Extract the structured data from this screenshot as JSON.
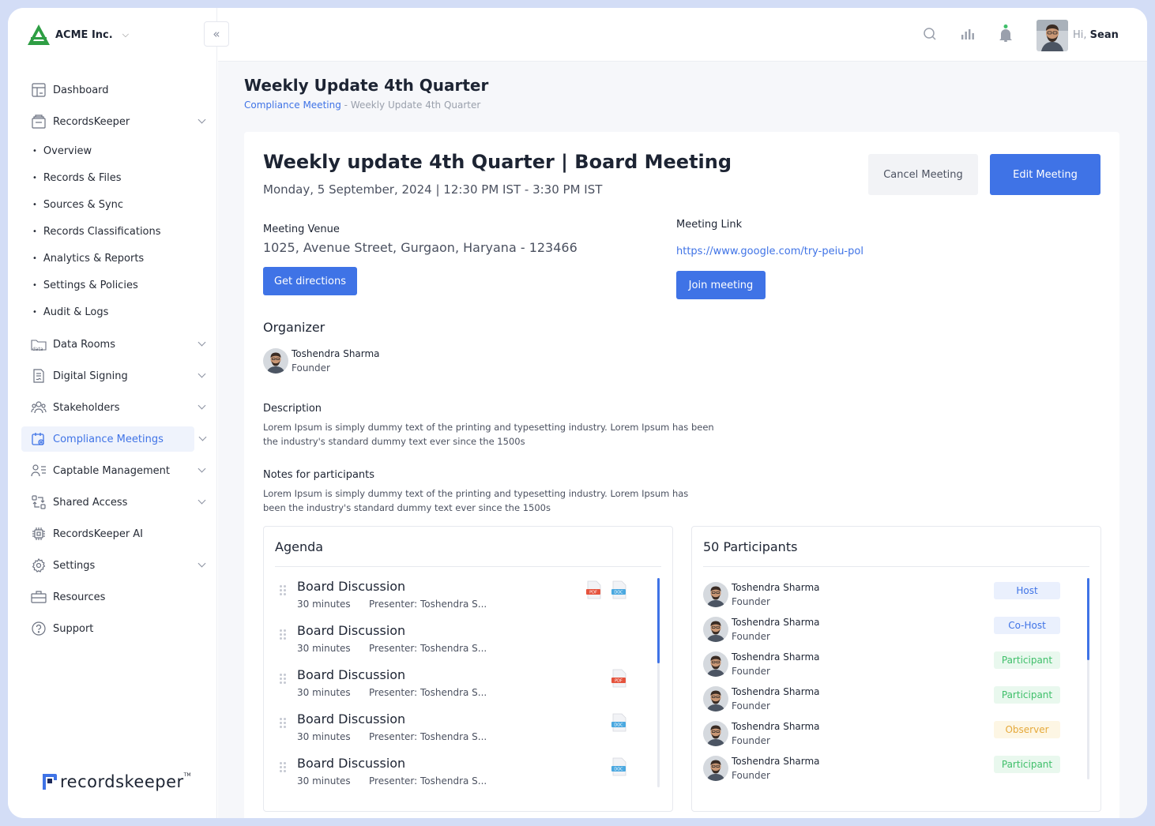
{
  "brand": {
    "name": "ACME Inc."
  },
  "sidebar": {
    "items": [
      {
        "label": "Dashboard"
      },
      {
        "label": "RecordsKeeper"
      },
      {
        "label": "Data Rooms"
      },
      {
        "label": "Digital Signing"
      },
      {
        "label": "Stakeholders"
      },
      {
        "label": "Compliance Meetings"
      },
      {
        "label": "Captable Management"
      },
      {
        "label": "Shared Access"
      },
      {
        "label": "RecordsKeeper AI"
      },
      {
        "label": "Settings"
      },
      {
        "label": "Resources"
      },
      {
        "label": "Support"
      }
    ],
    "subitems": [
      {
        "label": "Overview"
      },
      {
        "label": "Records & Files"
      },
      {
        "label": "Sources & Sync"
      },
      {
        "label": "Records Classifications"
      },
      {
        "label": "Analytics & Reports"
      },
      {
        "label": "Settings & Policies"
      },
      {
        "label": "Audit & Logs"
      }
    ],
    "footer_logo": "recordskeeper",
    "footer_tm": "TM"
  },
  "topbar": {
    "greeting": "Hi,",
    "user": "Sean"
  },
  "page": {
    "title": "Weekly Update 4th Quarter",
    "breadcrumb": {
      "parent": "Compliance Meeting",
      "separator": " - ",
      "current": "Weekly Update 4th Quarter"
    }
  },
  "meeting": {
    "title": "Weekly update 4th Quarter | Board Meeting",
    "date": "Monday, 5 September, 2024 | 12:30 PM IST - 3:30 PM IST",
    "cancel_label": "Cancel Meeting",
    "edit_label": "Edit Meeting",
    "venue_label": "Meeting Venue",
    "venue": "1025, Avenue Street, Gurgaon, Haryana - 123466",
    "directions_label": "Get directions",
    "link_label": "Meeting Link",
    "link": "https://www.google.com/try-peiu-pol",
    "join_label": "Join meeting",
    "organizer_label": "Organizer",
    "organizer": {
      "name": "Toshendra Sharma",
      "role": "Founder"
    },
    "description_label": "Description",
    "description_line1": "Lorem Ipsum is simply dummy text of the printing and typesetting industry. Lorem Ipsum has been",
    "description_line2": "the industry's standard dummy text ever since the 1500s",
    "notes_label": "Notes for participants",
    "notes_line1": "Lorem Ipsum is simply dummy text of the printing and typesetting industry. Lorem Ipsum has",
    "notes_line2": "been the industry's standard dummy text ever since the 1500s"
  },
  "agenda": {
    "title": "Agenda",
    "items": [
      {
        "title": "Board Discussion",
        "duration": "30 minutes",
        "presenter": "Presenter: Toshendra S...",
        "files": [
          "pdf",
          "doc"
        ]
      },
      {
        "title": "Board Discussion",
        "duration": "30 minutes",
        "presenter": "Presenter: Toshendra S...",
        "files": []
      },
      {
        "title": "Board Discussion",
        "duration": "30 minutes",
        "presenter": "Presenter: Toshendra S...",
        "files": [
          "pdf"
        ]
      },
      {
        "title": "Board Discussion",
        "duration": "30 minutes",
        "presenter": "Presenter: Toshendra S...",
        "files": [
          "doc"
        ]
      },
      {
        "title": "Board Discussion",
        "duration": "30 minutes",
        "presenter": "Presenter: Toshendra S...",
        "files": [
          "doc"
        ]
      }
    ],
    "file_labels": {
      "pdf": "PDF",
      "doc": "DOC"
    }
  },
  "participants": {
    "title": "50 Participants",
    "items": [
      {
        "name": "Toshendra Sharma",
        "role": "Founder",
        "badge": "Host"
      },
      {
        "name": "Toshendra Sharma",
        "role": "Founder",
        "badge": "Co-Host"
      },
      {
        "name": "Toshendra Sharma",
        "role": "Founder",
        "badge": "Participant"
      },
      {
        "name": "Toshendra Sharma",
        "role": "Founder",
        "badge": "Participant"
      },
      {
        "name": "Toshendra Sharma",
        "role": "Founder",
        "badge": "Observer"
      },
      {
        "name": "Toshendra Sharma",
        "role": "Founder",
        "badge": "Participant"
      }
    ]
  },
  "colors": {
    "accent": "#3f73e6",
    "host_bg": "#eaf0fd",
    "host_fg": "#3f73e6",
    "participant_bg": "#e9f8ee",
    "participant_fg": "#3fbf6a",
    "observer_bg": "#fdf6e4",
    "observer_fg": "#e5a93a",
    "notification_dot": "#3fbf6a",
    "pdf": "#e5533d",
    "doc": "#4aa8e0"
  }
}
